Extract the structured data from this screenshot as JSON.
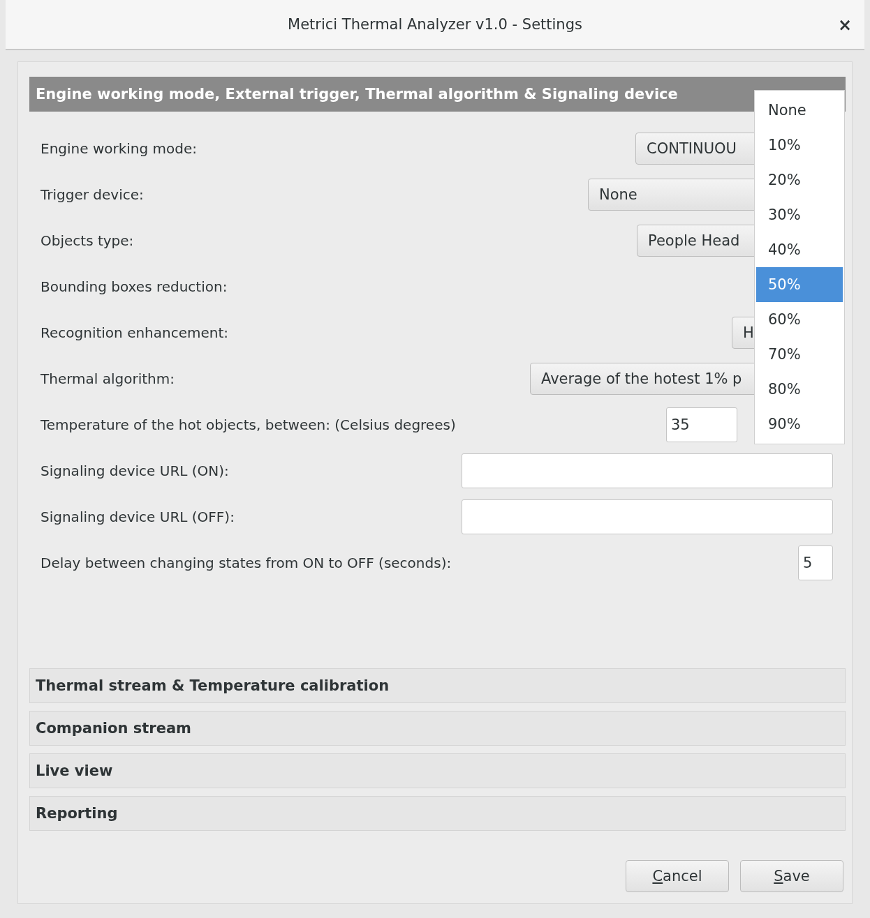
{
  "window": {
    "title": "Metrici Thermal Analyzer v1.0 - Settings",
    "close": "×"
  },
  "sections": [
    {
      "title": "Engine working mode, External trigger, Thermal algorithm & Signaling device",
      "expanded": true,
      "rows": [
        {
          "label": "Engine working mode:",
          "kind": "combo",
          "value": "CONTINUOU"
        },
        {
          "label": "Trigger device:",
          "kind": "combo",
          "value": "None"
        },
        {
          "label": "Objects type:",
          "kind": "combo",
          "value": "People Head"
        },
        {
          "label": "Bounding boxes reduction:",
          "kind": "hidden"
        },
        {
          "label": "Recognition enhancement:",
          "kind": "combo",
          "value": "H"
        },
        {
          "label": "Thermal algorithm:",
          "kind": "combo",
          "value": "Average of the hotest 1% p"
        },
        {
          "label": "Temperature of the hot objects, between: (Celsius degrees)",
          "kind": "entry",
          "value": "35"
        },
        {
          "label": "Signaling device URL (ON):",
          "kind": "entry"
        },
        {
          "label": "Signaling device URL (OFF):",
          "kind": "entry"
        },
        {
          "label": "Delay between changing states from ON to OFF (seconds):",
          "kind": "entry",
          "value": "5"
        }
      ]
    },
    {
      "title": "Thermal stream & Temperature calibration",
      "expanded": false
    },
    {
      "title": "Companion stream",
      "expanded": false
    },
    {
      "title": "Live view",
      "expanded": false
    },
    {
      "title": "Reporting",
      "expanded": false
    }
  ],
  "dropdown": {
    "options": [
      {
        "label": "None",
        "selected": false
      },
      {
        "label": "10%",
        "selected": false
      },
      {
        "label": "20%",
        "selected": false
      },
      {
        "label": "30%",
        "selected": false
      },
      {
        "label": "40%",
        "selected": false
      },
      {
        "label": "50%",
        "selected": true
      },
      {
        "label": "60%",
        "selected": false
      },
      {
        "label": "70%",
        "selected": false
      },
      {
        "label": "80%",
        "selected": false
      },
      {
        "label": "90%",
        "selected": false
      }
    ]
  },
  "buttons": [
    {
      "underlined": "C",
      "rest": "ancel"
    },
    {
      "underlined": "S",
      "rest": "ave"
    }
  ]
}
